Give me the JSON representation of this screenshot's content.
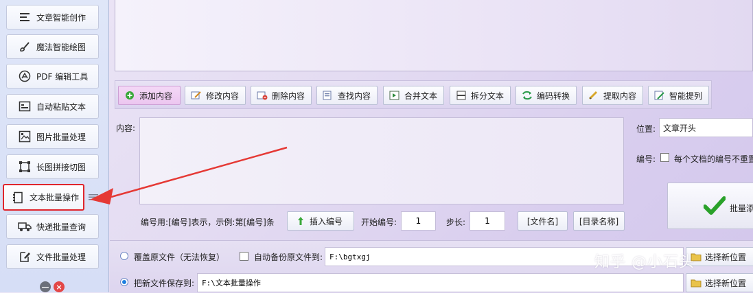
{
  "sidebar": {
    "items": [
      {
        "label": "文章智能创作",
        "icon": "lines-icon"
      },
      {
        "label": "魔法智能绘图",
        "icon": "magic-brush-icon"
      },
      {
        "label": "PDF 编辑工具",
        "icon": "pdf-icon"
      },
      {
        "label": "自动粘贴文本",
        "icon": "paste-icon"
      },
      {
        "label": "图片批量处理",
        "icon": "image-icon"
      },
      {
        "label": "长图拼接切图",
        "icon": "crop-icon"
      },
      {
        "label": "文本批量操作",
        "icon": "notebook-icon",
        "active": true
      },
      {
        "label": "快递批量查询",
        "icon": "truck-icon"
      },
      {
        "label": "文件批量处理",
        "icon": "file-edit-icon"
      }
    ],
    "minimize_symbol": "—",
    "close_symbol": "×"
  },
  "toolbar": {
    "buttons": [
      {
        "label": "添加内容",
        "icon": "add-icon",
        "active": true
      },
      {
        "label": "修改内容",
        "icon": "edit-icon"
      },
      {
        "label": "删除内容",
        "icon": "delete-icon"
      },
      {
        "label": "查找内容",
        "icon": "find-icon"
      },
      {
        "label": "合并文本",
        "icon": "merge-icon"
      },
      {
        "label": "拆分文本",
        "icon": "split-icon"
      },
      {
        "label": "编码转换",
        "icon": "convert-icon"
      },
      {
        "label": "提取内容",
        "icon": "extract-icon"
      },
      {
        "label": "智能提列",
        "icon": "smart-column-icon"
      }
    ]
  },
  "content": {
    "label": "内容:",
    "value": ""
  },
  "right_panel": {
    "position_label": "位置:",
    "position_value": "文章开头",
    "number_label": "编号:",
    "number_checkbox_text": "每个文档的编号不重置",
    "batch_add_label": "批量添"
  },
  "numbering": {
    "hint": "编号用:[编号]表示，示例:第[编号]条",
    "insert_button": "插入编号",
    "start_label": "开始编号:",
    "start_value": "1",
    "step_label": "步长:",
    "step_value": "1",
    "filename_tag": "[文件名]",
    "dirname_tag": "[目录名称]"
  },
  "save_options": {
    "overwrite_label": "覆盖原文件（无法恢复）",
    "backup_label": "自动备份原文件到:",
    "backup_path": "F:\\bgtxgj",
    "choose_location_1": "选择新位置",
    "save_new_label": "把新文件保存到:",
    "save_new_path": "F:\\文本批量操作",
    "choose_location_2": "选择新位置"
  },
  "watermark": "知乎 @小石头",
  "colors": {
    "active_highlight": "#e0252c",
    "arrow": "#e53935",
    "checkmark": "#2aa12a"
  }
}
